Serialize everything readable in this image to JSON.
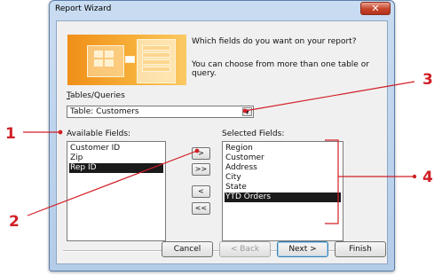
{
  "window": {
    "title": "Report Wizard",
    "close_glyph": "✕"
  },
  "banner": {
    "icon": "report-wizard-illustration"
  },
  "instructions": {
    "line1": "Which fields do you want on your report?",
    "line2": "You can choose from more than one table or query."
  },
  "tables_queries": {
    "label": "Tables/Queries",
    "selected": "Table: Customers"
  },
  "available_fields": {
    "label": "Available Fields:",
    "items": [
      "Customer ID",
      "Zip",
      "Rep ID"
    ],
    "selected_index": 2
  },
  "selected_fields": {
    "label": "Selected Fields:",
    "items": [
      "Region",
      "Customer",
      "Address",
      "City",
      "State",
      "YTD Orders"
    ],
    "selected_index": 5
  },
  "move_buttons": {
    "add_one": ">",
    "add_all": ">>",
    "remove_one": "<",
    "remove_all": "<<"
  },
  "footer": {
    "cancel": "Cancel",
    "back": "< Back",
    "next": "Next >",
    "finish": "Finish"
  },
  "callouts": {
    "one": "1",
    "two": "2",
    "three": "3",
    "four": "4"
  },
  "colors": {
    "callout": "#d11f26",
    "selection": "#1a1a1a",
    "banner": "#f08f17"
  }
}
